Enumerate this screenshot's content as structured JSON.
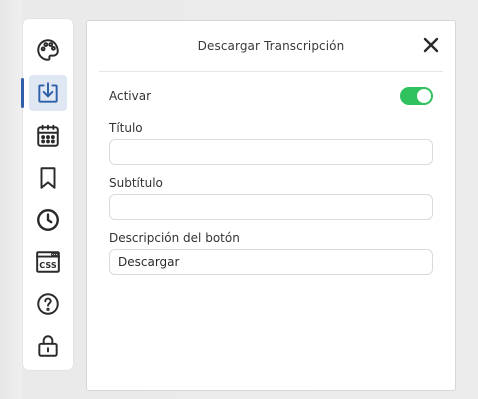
{
  "panel": {
    "title": "Descargar Transcripción",
    "activate_label": "Activar",
    "activate_on": true,
    "fields": [
      {
        "label": "Título",
        "value": ""
      },
      {
        "label": "Subtítulo",
        "value": ""
      },
      {
        "label": "Descripción del botón",
        "value": "Descargar"
      }
    ]
  },
  "sidebar": {
    "items": [
      {
        "icon": "palette-icon"
      },
      {
        "icon": "download-icon",
        "active": true
      },
      {
        "icon": "calendar-icon"
      },
      {
        "icon": "bookmark-icon"
      },
      {
        "icon": "clock-icon"
      },
      {
        "icon": "css-icon",
        "text": "CSS"
      },
      {
        "icon": "help-icon"
      },
      {
        "icon": "lock-icon"
      }
    ]
  },
  "colors": {
    "accent": "#2f5fa8",
    "toggle_on": "#2fc25f"
  }
}
